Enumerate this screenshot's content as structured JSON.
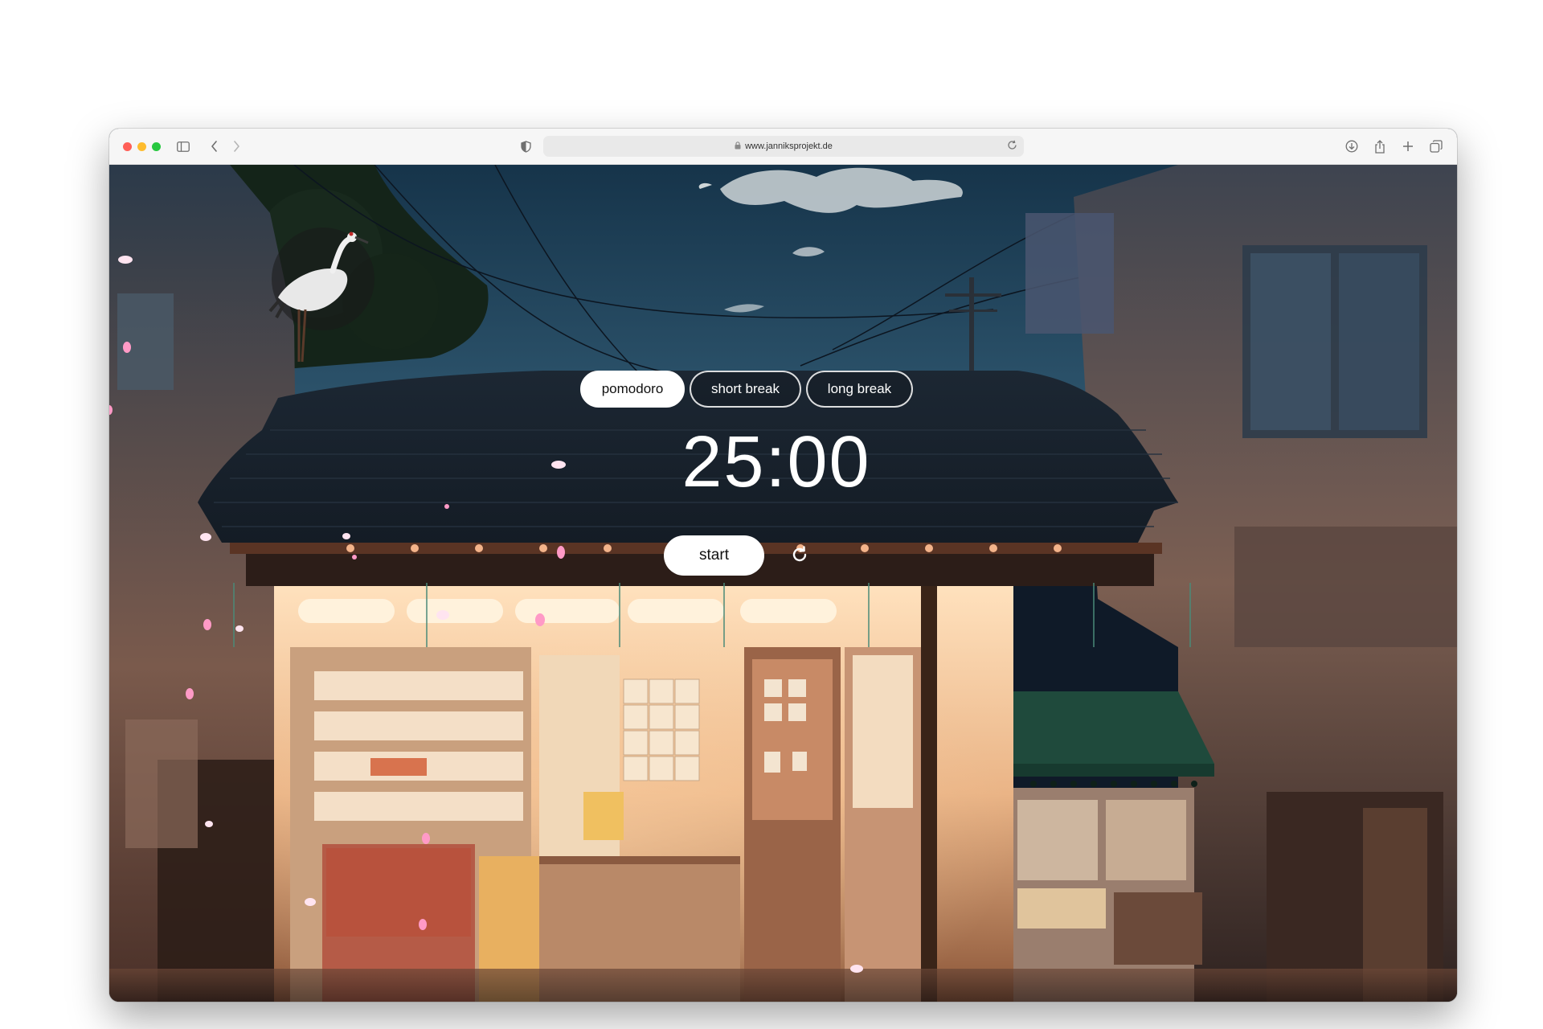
{
  "browser": {
    "url": "www.janniksprojekt.de",
    "icons": [
      "sidebar-icon",
      "back-icon",
      "forward-icon",
      "privacy-shield-icon",
      "lock-icon",
      "reload-icon",
      "download-icon",
      "share-icon",
      "new-tab-icon",
      "tab-overview-icon"
    ]
  },
  "timer": {
    "modes": [
      {
        "label": "pomodoro",
        "active": true
      },
      {
        "label": "short break",
        "active": false
      },
      {
        "label": "long break",
        "active": false
      }
    ],
    "time": "25:00",
    "start_label": "start",
    "reset_icon": "refresh-icon"
  },
  "scene": {
    "logo": "crane-logo",
    "background": "anime night street with convenience store and falling cherry blossom petals"
  },
  "colors": {
    "sky": "#1d3a50",
    "roof": "#1a2530",
    "shop_glow": "#f3c89a",
    "awning": "#1f4a3c",
    "petal": "#ff8fbf",
    "active_mode_bg": "#ffffff"
  }
}
